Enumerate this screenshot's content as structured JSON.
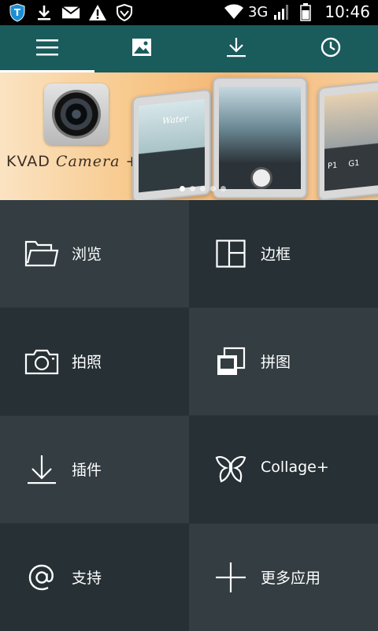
{
  "status_bar": {
    "left_icons": [
      "shield-t-icon",
      "download-icon",
      "mail-icon",
      "warning-icon",
      "vpn-shield-icon"
    ],
    "network": "3G",
    "time": "10:46"
  },
  "toolbar": {
    "tabs": [
      {
        "icon": "menu-icon",
        "active": true
      },
      {
        "icon": "image-icon",
        "active": false
      },
      {
        "icon": "download-icon",
        "active": false
      },
      {
        "icon": "clock-icon",
        "active": false
      }
    ]
  },
  "banner": {
    "brand_prefix": "KVAD",
    "brand_script": "Camera +",
    "phone_caption": "Water",
    "filter_labels": [
      "P1",
      "G1"
    ],
    "page_count": 5,
    "active_page": 1
  },
  "grid": {
    "items": [
      {
        "label": "浏览",
        "icon": "folder-icon"
      },
      {
        "label": "边框",
        "icon": "frame-layout-icon"
      },
      {
        "label": "拍照",
        "icon": "camera-icon"
      },
      {
        "label": "拼图",
        "icon": "collage-icon"
      },
      {
        "label": "插件",
        "icon": "download-icon"
      },
      {
        "label": "Collage+",
        "icon": "butterfly-icon"
      },
      {
        "label": "支持",
        "icon": "at-icon"
      },
      {
        "label": "更多应用",
        "icon": "plus-icon"
      }
    ]
  },
  "colors": {
    "toolbar": "#1a5b5c",
    "cell_dark": "#263035",
    "cell_light": "#333d42"
  }
}
